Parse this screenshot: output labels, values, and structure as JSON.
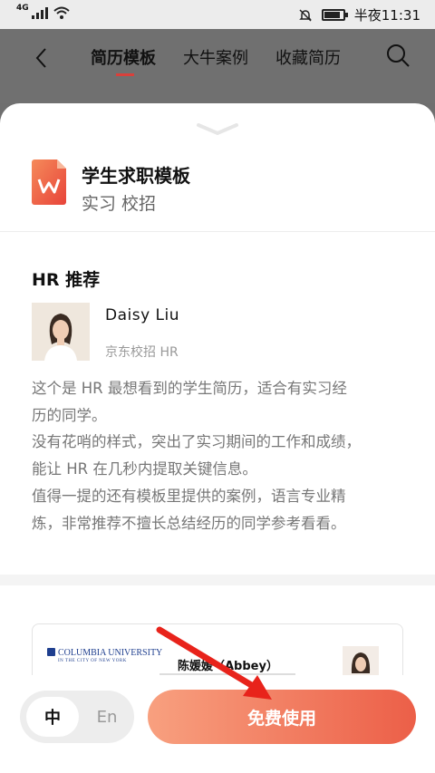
{
  "status_bar": {
    "network": "4G",
    "time": "半夜11:31"
  },
  "header": {
    "tabs": [
      {
        "label": "简历模板",
        "active": true
      },
      {
        "label": "大牛案例",
        "active": false
      },
      {
        "label": "收藏简历",
        "active": false
      }
    ]
  },
  "template": {
    "title": "学生求职模板",
    "tags": "实习 校招",
    "icon": "wps-w-icon"
  },
  "hr": {
    "section_title": "HR 推荐",
    "name": "Daisy  Liu",
    "company": "京东校招  HR",
    "description_lines": [
      "这个是  HR  最想看到的学生简历，适合有实习经",
      "历的同学。",
      "没有花哨的样式，突出了实习期间的工作和成绩，",
      "能让  HR  在几秒内提取关键信息。",
      "值得一提的还有模板里提供的案例，语言专业精",
      "炼，非常推荐不擅长总结经历的同学参考看看。"
    ]
  },
  "preview": {
    "university": "COLUMBIA UNIVERSITY",
    "university_sub": "IN THE CITY OF NEW YORK",
    "resume_name": "陈媛媛（Abbey）"
  },
  "bottom": {
    "lang_zh": "中",
    "lang_en": "En",
    "use_button": "免费使用"
  },
  "colors": {
    "accent": "#d9403b",
    "button_start": "#f8a07f",
    "button_end": "#ec5f48",
    "annotation_arrow": "#e8231b"
  }
}
